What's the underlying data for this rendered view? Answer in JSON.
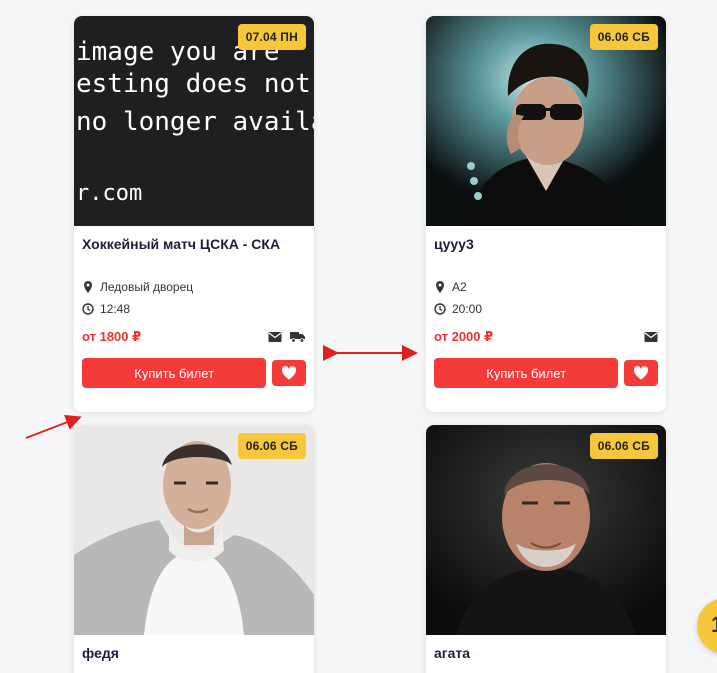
{
  "colors": {
    "accent": "#f53a3a",
    "price": "#ee3333",
    "badge": "#f7c73b",
    "title": "#1e1e3a",
    "annotation": "#e31e1e"
  },
  "placeholder_image_text": [
    "image you are",
    "esting does not",
    "no longer availa",
    "r.com"
  ],
  "cards": [
    {
      "date": "07.04 ПН",
      "title": "Хоккейный матч ЦСКА - СКА",
      "venue": "Ледовый дворец",
      "time": "12:48",
      "price": "от 1800 ₽",
      "buy_label": "Купить билет",
      "icons": [
        "envelope-icon",
        "truck-icon"
      ]
    },
    {
      "date": "06.06 СБ",
      "title": "цууу3",
      "venue": "А2",
      "time": "20:00",
      "price": "от 2000 ₽",
      "buy_label": "Купить билет",
      "icons": [
        "envelope-icon"
      ]
    },
    {
      "date": "06.06 СБ",
      "title": "федя"
    },
    {
      "date": "06.06 СБ",
      "title": "агата"
    }
  ],
  "fab": {
    "glyph": "1"
  }
}
